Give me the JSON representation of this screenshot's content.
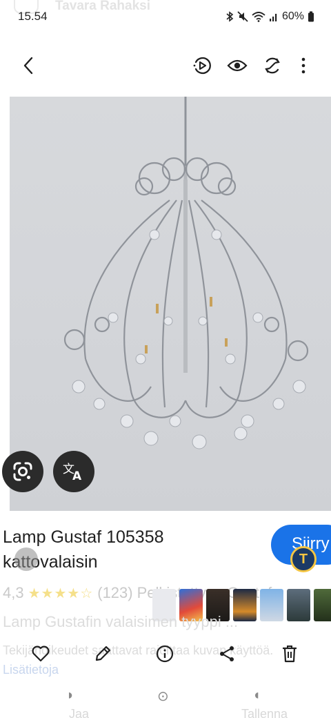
{
  "status_bar": {
    "time": "15.54",
    "battery": "60%",
    "icons": [
      "bluetooth-icon",
      "mute-icon",
      "wifi-icon",
      "signal-icon",
      "battery-icon"
    ]
  },
  "background_app": {
    "title": "Tavara Rahaksi"
  },
  "toolbar": {
    "icons": [
      "back-icon",
      "motion-photo-icon",
      "eye-icon",
      "rotate-icon",
      "more-icon"
    ]
  },
  "overlay_buttons": [
    "lens-icon",
    "translate-icon"
  ],
  "result": {
    "title": "Lamp Gustaf 105358 kattovalaisin",
    "visit_label": "Siirry",
    "badge_letter": "T",
    "rating": "4,3",
    "stars_filled": 4,
    "stars_total": 5,
    "reviews": "(123)",
    "seller_hint": "Pelkistetty ... Gustaf",
    "description": "Lamp Gustafin valaisimen tyyppi ...",
    "rights_text": "Tekijänoikeudet saattavat rajoittaa kuvan käyttöä.",
    "more_info": "Lisätietoja"
  },
  "action_bar": {
    "icons": [
      "heart-icon",
      "edit-icon",
      "info-icon",
      "share-icon",
      "delete-icon"
    ]
  },
  "bottom": {
    "left": "Jaa",
    "right": "Tallenna"
  },
  "colors": {
    "accent_blue": "#1a73e8",
    "overlay_dark": "#2b2b2b",
    "badge_navy": "#1b3a66",
    "badge_gold": "#f4c542"
  }
}
